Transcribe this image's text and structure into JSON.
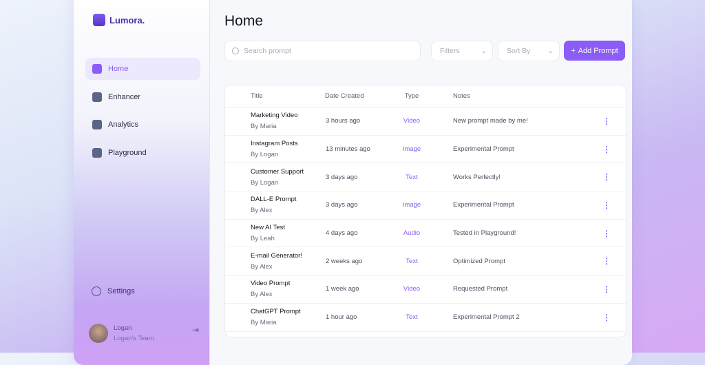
{
  "app": {
    "name": "Lumora."
  },
  "sidebar": {
    "items": [
      {
        "label": "Home",
        "active": true
      },
      {
        "label": "Enhancer"
      },
      {
        "label": "Analytics"
      },
      {
        "label": "Playground"
      }
    ],
    "settings": "Settings",
    "user": {
      "name": "Logan",
      "team": "Logan's Team"
    }
  },
  "main": {
    "title": "Home",
    "search_placeholder": "Search prompt",
    "filters": "Filters",
    "sort": "Sort By",
    "add": "Add Prompt",
    "columns": [
      "Title",
      "Date Created",
      "Type",
      "Notes"
    ],
    "rows": [
      {
        "title": "Marketing Video",
        "by": "By Maria",
        "date": "3 hours ago",
        "type": "Video",
        "notes": "New prompt made by me!"
      },
      {
        "title": "Instagram Posts",
        "by": "By Logan",
        "date": "13 minutes ago",
        "type": "Image",
        "notes": "Experimental Prompt"
      },
      {
        "title": "Customer Support",
        "by": "By Logan",
        "date": "3 days ago",
        "type": "Text",
        "notes": "Works Perfectly!"
      },
      {
        "title": "DALL-E Prompt",
        "by": "By Alex",
        "date": "3 days ago",
        "type": "Image",
        "notes": "Experimental Prompt"
      },
      {
        "title": "New AI Test",
        "by": "By Leah",
        "date": "4 days ago",
        "type": "Audio",
        "notes": "Tested in Playground!"
      },
      {
        "title": "E-mail Generator!",
        "by": "By Alex",
        "date": "2 weeks ago",
        "type": "Text",
        "notes": "Optimized Prompt"
      },
      {
        "title": "Video Prompt",
        "by": "By Alex",
        "date": "1 week ago",
        "type": "Video",
        "notes": "Requested Prompt"
      },
      {
        "title": "ChatGPT Prompt",
        "by": "By Maria",
        "date": "1 hour ago",
        "type": "Text",
        "notes": "Experimental Prompt 2"
      }
    ]
  },
  "colors": {
    "accent": "#8b5cf6"
  }
}
